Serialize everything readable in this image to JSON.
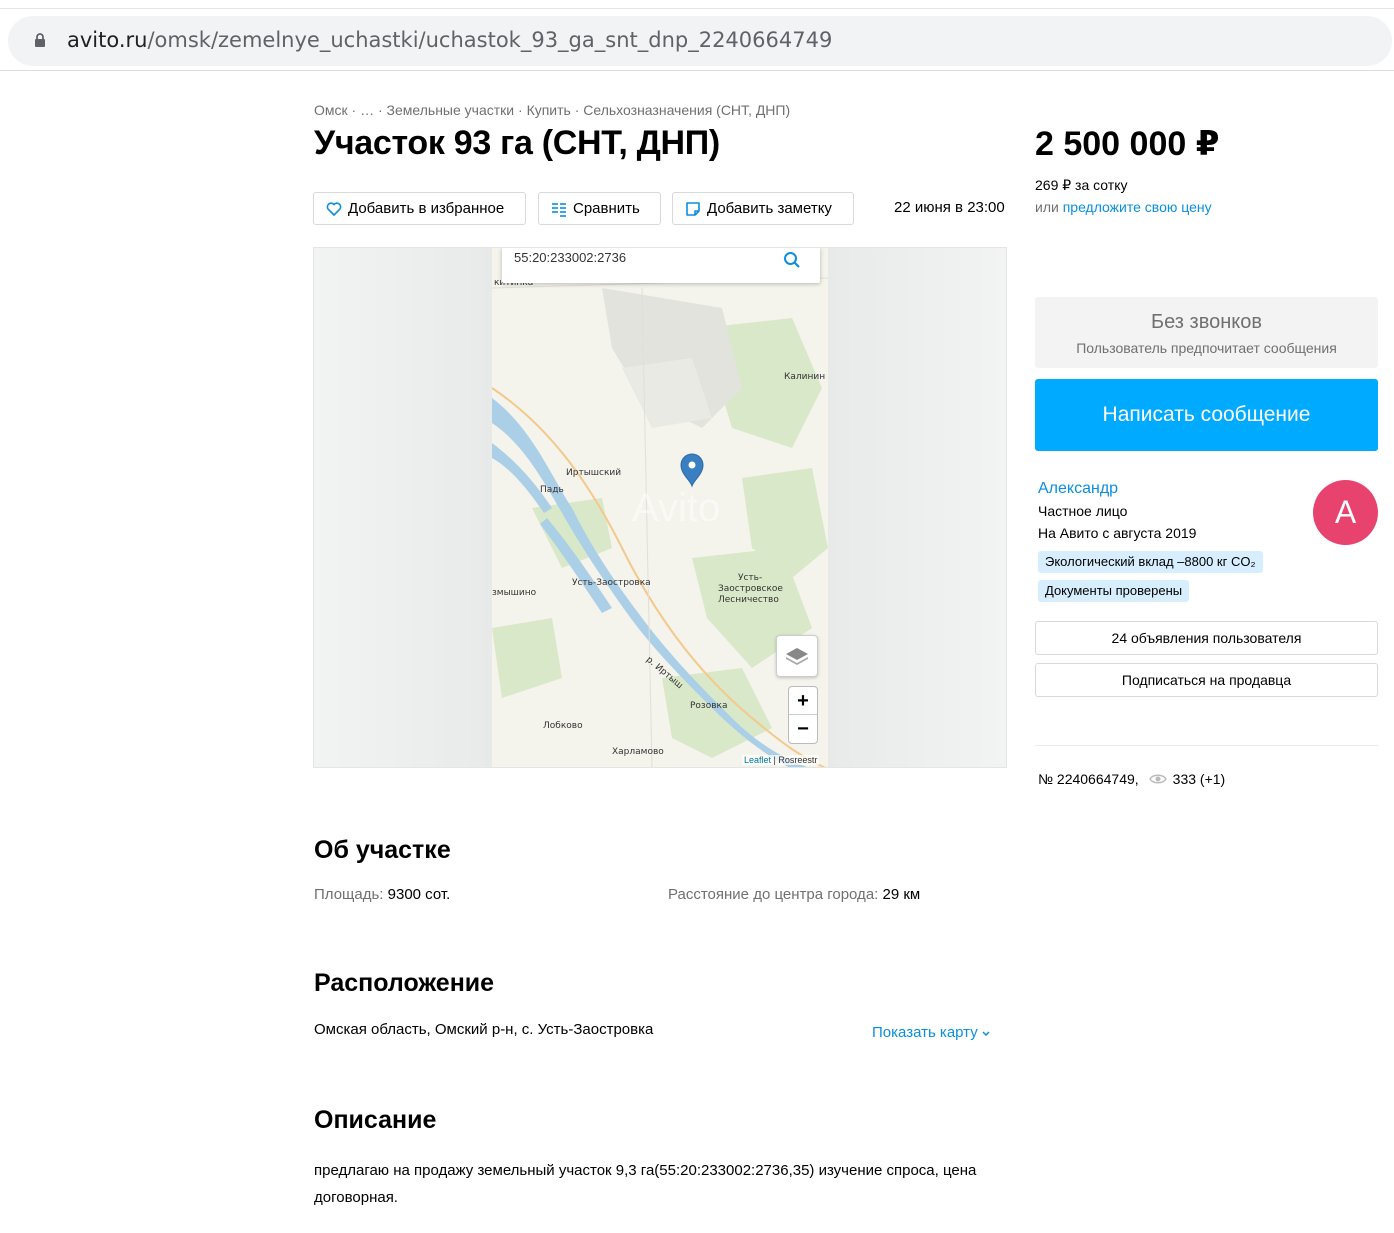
{
  "browser": {
    "url_domain": "avito.ru",
    "url_path": "/omsk/zemelnye_uchastki/uchastok_93_ga_snt_dnp_2240664749"
  },
  "breadcrumbs": [
    "Омск",
    "…",
    "Земельные участки",
    "Купить",
    "Сельхозназначения (СНТ, ДНП)"
  ],
  "breadcrumb_sep": " · ",
  "listing": {
    "title": "Участок 93 га (СНТ, ДНП)",
    "favorite_label": "Добавить в избранное",
    "compare_label": "Сравнить",
    "note_label": "Добавить заметку",
    "date": "22 июня в 23:00"
  },
  "map": {
    "search_value": "55:20:233002:2736",
    "attribution_leaflet": "Leaflet",
    "attribution_sep": " | ",
    "attribution_source": "Rosreestr",
    "zoom_in": "+",
    "zoom_out": "−",
    "labels": {
      "kitinka": "китинка",
      "kalinin": "Калинин",
      "irtyshsky": "Иртышский",
      "pad": "Падь",
      "ust_zaostrovka": "Усть-Заостровка",
      "zamyshino": "змышино",
      "leshnichestvo_1": "Усть-",
      "leshnichestvo_2": "Заостровское",
      "leshnichestvo_3": "Лесничество",
      "river": "р. Иртыш",
      "rozovka": "Розовка",
      "lobkovo": "Лобково",
      "kharlamovo": "Харламово",
      "watermark": "Avito"
    }
  },
  "pricing": {
    "price": "2 500 000 ₽",
    "per_unit": "269 ₽ за сотку",
    "offer_prefix": "или ",
    "offer_link": "предложите свою цену"
  },
  "contact": {
    "no_calls_title": "Без звонков",
    "no_calls_sub": "Пользователь предпочитает сообщения",
    "message_button": "Написать сообщение"
  },
  "seller": {
    "name": "Александр",
    "type": "Частное лицо",
    "since": "На Авито с августа 2019",
    "avatar_letter": "А",
    "avatar_color": "#e8436f",
    "badges": [
      "Экологический вклад –8800 кг CO₂",
      "Документы проверены"
    ],
    "ads_button": "24 объявления пользователя",
    "subscribe_button": "Подписаться на продавца"
  },
  "stats": {
    "ad_number": "№ 2240664749,",
    "views": "333 (+1)"
  },
  "about": {
    "title": "Об участке",
    "area_label": "Площадь: ",
    "area_value": "9300 сот.",
    "distance_label": "Расстояние до центра города: ",
    "distance_value": "29 км"
  },
  "location": {
    "title": "Расположение",
    "address": "Омская область, Омский р-н, с. Усть-Заостровка",
    "show_map": "Показать карту"
  },
  "description": {
    "title": "Описание",
    "text": "предлагаю на продажу земельный участок 9,3 га(55:20:233002:2736,35) изучение спроса, цена договорная."
  },
  "colors": {
    "accent": "#00aaff",
    "link": "#0a8fdf",
    "badge_bg": "#d6eefd",
    "marker": "#3a7fc1"
  }
}
